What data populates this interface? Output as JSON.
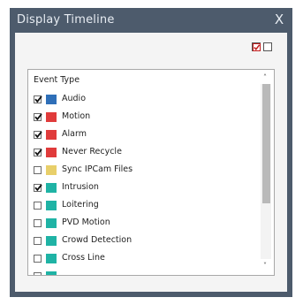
{
  "window": {
    "title": "Display Timeline",
    "close_glyph": "X"
  },
  "toolbar": {
    "check_all_icon": "checked-box-icon",
    "uncheck_all_icon": "unchecked-box-icon",
    "accent": "#c41e1e"
  },
  "list": {
    "header": "Event Type",
    "items": [
      {
        "label": "Audio",
        "checked": true,
        "color": "#2f6fb8"
      },
      {
        "label": "Motion",
        "checked": true,
        "color": "#e03b3b"
      },
      {
        "label": "Alarm",
        "checked": true,
        "color": "#e03b3b"
      },
      {
        "label": "Never Recycle",
        "checked": true,
        "color": "#e03b3b"
      },
      {
        "label": "Sync IPCam Files",
        "checked": false,
        "color": "#e8cf6a"
      },
      {
        "label": "Intrusion",
        "checked": true,
        "color": "#1fb3a5"
      },
      {
        "label": "Loitering",
        "checked": false,
        "color": "#1fb3a5"
      },
      {
        "label": "PVD Motion",
        "checked": false,
        "color": "#1fb3a5"
      },
      {
        "label": "Crowd Detection",
        "checked": false,
        "color": "#1fb3a5"
      },
      {
        "label": "Cross Line",
        "checked": false,
        "color": "#1fb3a5"
      },
      {
        "label": "",
        "checked": false,
        "color": "#1fb3a5"
      }
    ]
  },
  "scrollbar": {
    "up_glyph": "˄",
    "down_glyph": "˅"
  }
}
